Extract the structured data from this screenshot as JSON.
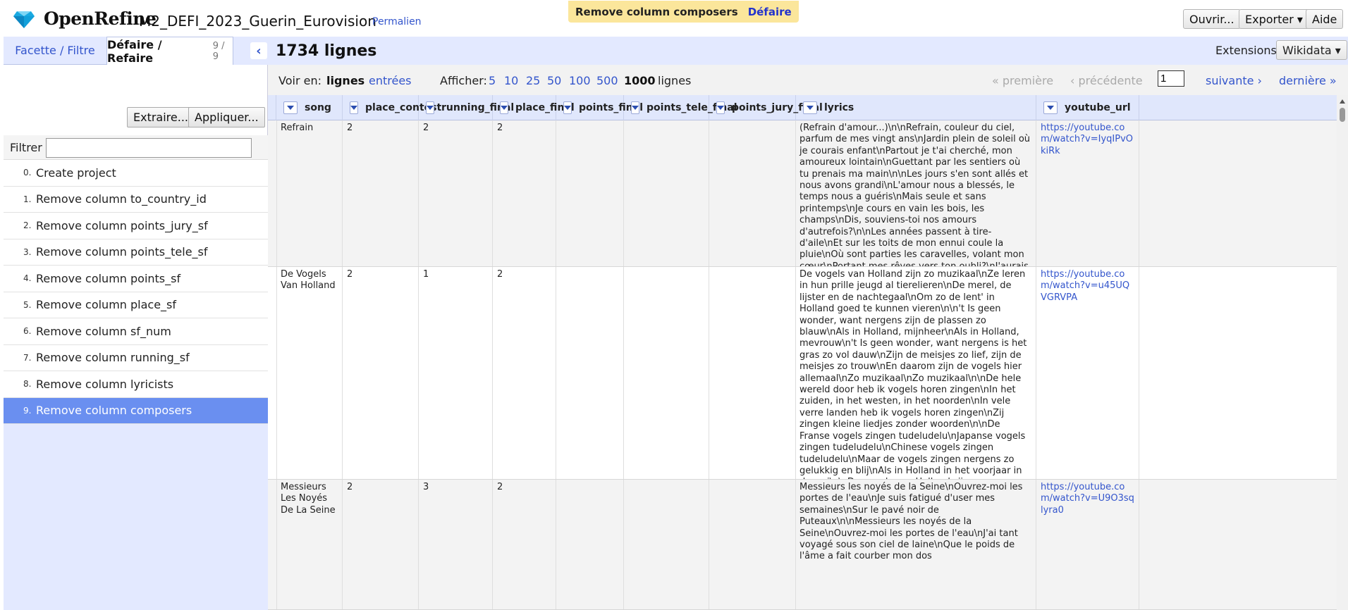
{
  "app": {
    "brand": "OpenRefine",
    "project_name": "M2_DEFI_2023_Guerin_Eurovision",
    "permalink": "Permalien",
    "notification": {
      "text": "Remove column composers",
      "undo": "Défaire"
    },
    "buttons": {
      "open": "Ouvrir...",
      "export": "Exporter ▾",
      "help": "Aide"
    }
  },
  "left_panel": {
    "tab_facet": "Facette / Filtre",
    "tab_undo": "Défaire / Refaire",
    "tab_undo_count": "9 / 9",
    "extract_button": "Extraire...",
    "apply_button": "Appliquer...",
    "filter_label": "Filtrer",
    "history": [
      {
        "num": "0.",
        "label": "Create project"
      },
      {
        "num": "1.",
        "label": "Remove column to_country_id"
      },
      {
        "num": "2.",
        "label": "Remove column points_jury_sf"
      },
      {
        "num": "3.",
        "label": "Remove column points_tele_sf"
      },
      {
        "num": "4.",
        "label": "Remove column points_sf"
      },
      {
        "num": "5.",
        "label": "Remove column place_sf"
      },
      {
        "num": "6.",
        "label": "Remove column sf_num"
      },
      {
        "num": "7.",
        "label": "Remove column running_sf"
      },
      {
        "num": "8.",
        "label": "Remove column lyricists"
      },
      {
        "num": "9.",
        "label": "Remove column composers"
      }
    ]
  },
  "right_panel": {
    "summary": "1734 lignes",
    "extensions_label": "Extensions",
    "wikidata_button": "Wikidata ▾",
    "view": {
      "label": "Voir en:",
      "rows": "lignes",
      "records": "entrées",
      "show_label": "Afficher:",
      "sizes": [
        "5",
        "10",
        "25",
        "50",
        "100",
        "500"
      ],
      "current_size": "1000",
      "unit": "lignes"
    },
    "pager": {
      "first": "« première",
      "previous": "‹ précédente",
      "page": "1",
      "next": "suivante ›",
      "last": "dernière »"
    }
  },
  "grid": {
    "columns": [
      "song",
      "place_contest",
      "running_final",
      "place_final",
      "points_final",
      "points_tele_final",
      "points_jury_final",
      "lyrics",
      "youtube_url"
    ],
    "rows": [
      {
        "song": "Refrain",
        "place_contest": "2",
        "running_final": "2",
        "place_final": "2",
        "points_final": "",
        "points_tele_final": "",
        "points_jury_final": "",
        "lyrics": "(Refrain d'amour...)\\n\\nRefrain, couleur du ciel, parfum de mes vingt ans\\nJardin plein de soleil où je courais enfant\\nPartout je t'ai cherché, mon amoureux lointain\\nGuettant par les sentiers où tu prenais ma main\\n\\nLes jours s'en sont allés et nous avons grandi\\nL'amour nous a blessés, le temps nous a guéris\\nMais seule et sans printemps\\nJe cours en vain les bois, les champs\\nDis, souviens-toi nos amours d'autrefois?\\n\\nLes années passent à tire-d'aile\\nEt sur les toits de mon ennui coule la pluie\\nOù sont parties les caravelles, volant mon cœur\\nPortant mes rêves vers ton oubli?\\nJ'aurais voulu que tu reviennes comme jadis\\nPorter des fleurs à ma persienne\\nEt ta jeunesse en mon logis\\n\\nRefrain, couleur de pluie, regret de mes vingt ans\\nChagrin, mélancolie de n'être plus enfant\\nMais seule et loin de toi, par les chemins où tu n'es pas\\nJe vais, pleurant mes amours de vingt ans",
        "youtube_url": "https://youtube.com/watch?v=IyqIPvOkiRk"
      },
      {
        "song": "De Vogels Van Holland",
        "place_contest": "2",
        "running_final": "1",
        "place_final": "2",
        "points_final": "",
        "points_tele_final": "",
        "points_jury_final": "",
        "lyrics": "De vogels van Holland zijn zo muzikaal\\nZe leren in hun prille jeugd al tierelieren\\nDe merel, de lijster en de nachtegaal\\nOm zo de lent' in Holland goed te kunnen vieren\\n\\n't Is geen wonder, want nergens zijn de plassen zo blauw\\nAls in Holland, mijnheer\\nAls in Holland, mevrouw\\n't Is geen wonder, want nergens is het gras zo vol dauw\\nZijn de meisjes zo lief, zijn de meisjes zo trouw\\nEn daarom zijn de vogels hier allemaal\\nZo muzikaal\\nZo muzikaal\\n\\nDe hele wereld door heb ik vogels horen zingen\\nIn het zuiden, in het westen, in het noorden\\nIn vele verre landen heb ik vogels horen zingen\\nZij zingen kleine liedjes zonder woorden\\n\\nDe Franse vogels zingen tudeludelu\\nJapanse vogels zingen tudeludelu\\nChinese vogels zingen tudeludelu\\nMaar de vogels zingen nergens zo gelukkig en blij\\nAls in Holland in het voorjaar in de wei\\n\\nDe vogels van Holland zijn zo muzikaal\\nZe leren in hun prille jeugd al tierelieren\\nDe merel, de lijster en de nachtegaal\\nOm zo de lent' in Holland goed te kunnen vieren\\n\\n't Is geen wonder, want nergens zijn de plassen zo blauw\\nAls in Holland, mijnheer\\nAls in Holland, mevrouw\\n't Is geen wonder want nergens is het gras zo vol dauw\\nZijn de meisjes zo lief, zijn de meisjes zo trouw\\nEn daarom zijn de vogels hier allemaal\\nZo muzikaal\\nZo muzikaal",
        "youtube_url": "https://youtube.com/watch?v=u45UQVGRVPA"
      },
      {
        "song": "Messieurs Les Noyés De La Seine",
        "place_contest": "2",
        "running_final": "3",
        "place_final": "2",
        "points_final": "",
        "points_tele_final": "",
        "points_jury_final": "",
        "lyrics": "Messieurs les noyés de la Seine\\nOuvrez-moi les portes de l'eau\\nJe suis fatigué d'user mes semaines\\nSur le pavé noir de Puteaux\\n\\nMessieurs les noyés de la Seine\\nOuvrez-moi les portes de l'eau\\nJ'ai tant voyagé sous son ciel de laine\\nQue le poids de l'âme a fait courber mon dos",
        "youtube_url": "https://youtube.com/watch?v=U9O3sqlyra0"
      }
    ]
  },
  "colors": {
    "accent": "#3355cc",
    "panel_bg": "#e3e9ff",
    "selected": "#6a8ff0",
    "notification": "#fbe69b"
  }
}
